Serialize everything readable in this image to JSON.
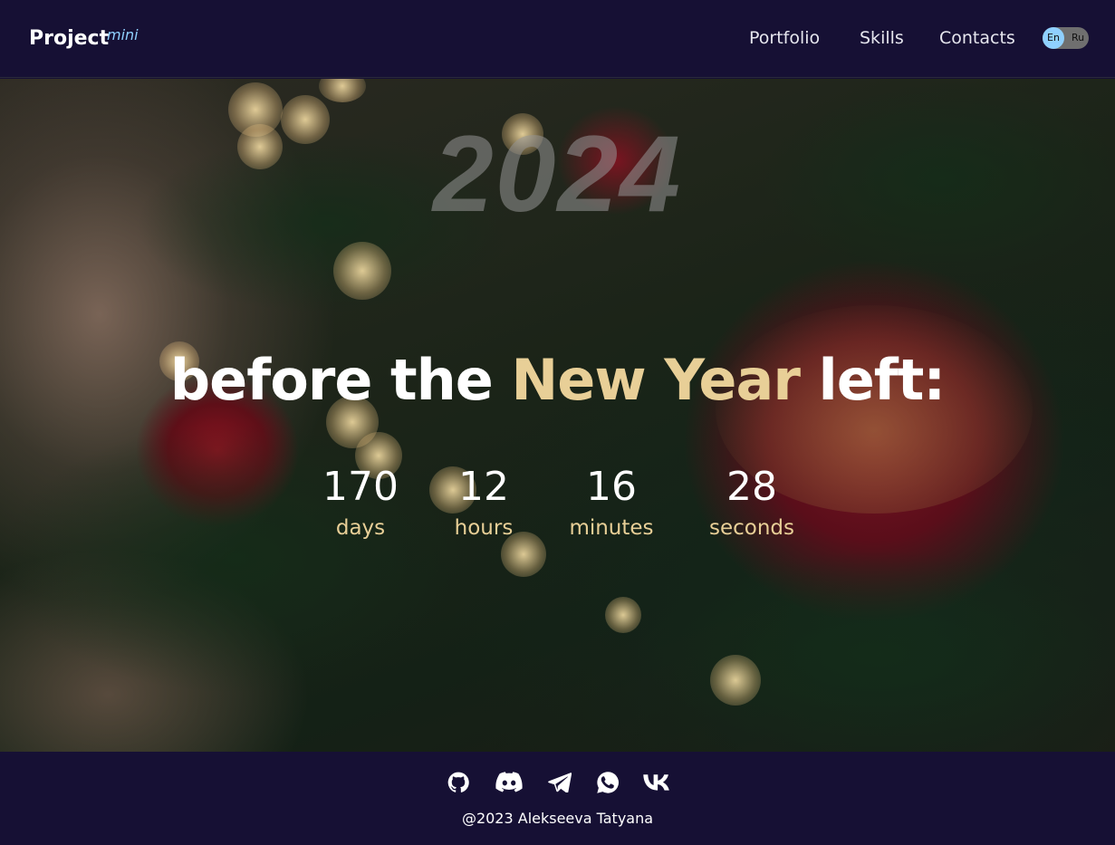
{
  "header": {
    "logo": "Project",
    "logo_sup": "mini",
    "nav": [
      {
        "label": "Portfolio"
      },
      {
        "label": "Skills"
      },
      {
        "label": "Contacts"
      }
    ],
    "lang": {
      "en": "En",
      "ru": "Ru",
      "active": "En"
    }
  },
  "hero": {
    "year": "2024",
    "title_before": "before the ",
    "title_accent": "New Year",
    "title_after": " left:",
    "counters": [
      {
        "value": "170",
        "label": "days"
      },
      {
        "value": "12",
        "label": "hours"
      },
      {
        "value": "16",
        "label": "minutes"
      },
      {
        "value": "28",
        "label": "seconds"
      }
    ]
  },
  "footer": {
    "icons": [
      "github-icon",
      "discord-icon",
      "telegram-icon",
      "whatsapp-icon",
      "vk-icon"
    ],
    "copyright": "@2023 Alekseeva Tatyana"
  },
  "colors": {
    "header_bg": "#161034",
    "accent_gold": "#e8cf97",
    "accent_blue": "#8fd0ff"
  }
}
